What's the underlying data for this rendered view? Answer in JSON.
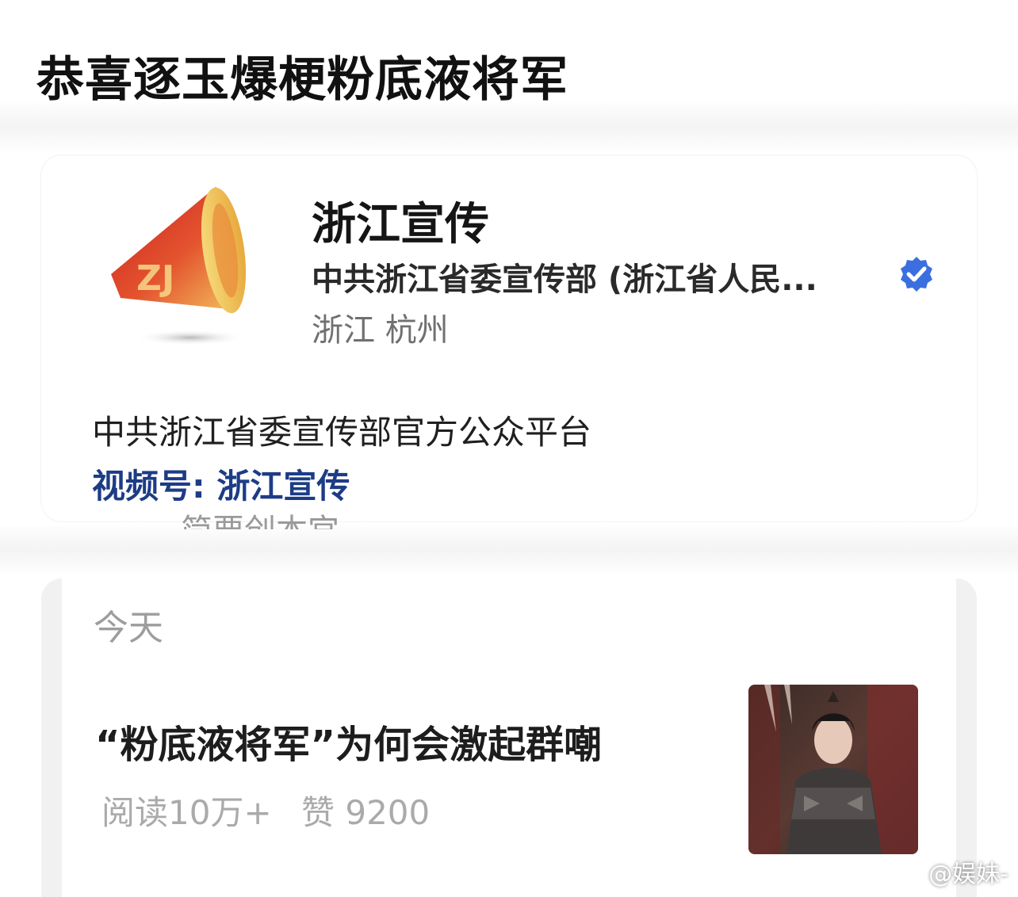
{
  "headline": "恭喜逐玉爆梗粉底液将军",
  "profile": {
    "account_name": "浙江宣传",
    "organization": "中共浙江省委宣传部 (浙江省人民...",
    "location": "浙江 杭州",
    "description": "中共浙江省委宣传部官方公众平台",
    "channel": "视频号: 浙江宣传",
    "faded_text": "简要创本宫",
    "verified_icon": "verified-badge-icon",
    "logo_icon": "megaphone-logo-icon",
    "logo_text": "ZJ"
  },
  "article_list": {
    "date_label": "今天",
    "article": {
      "title": "“粉底液将军”为何会激起群嘲",
      "reads": "阅读10万+",
      "likes": "赞 9200"
    }
  },
  "watermark": {
    "text": "@娱妹-",
    "icon": "weibo-icon"
  },
  "colors": {
    "channel_blue": "#1d3c86",
    "verified_blue": "#3b6fe0",
    "logo_red": "#d9302c",
    "logo_yellow": "#f2c15a"
  }
}
